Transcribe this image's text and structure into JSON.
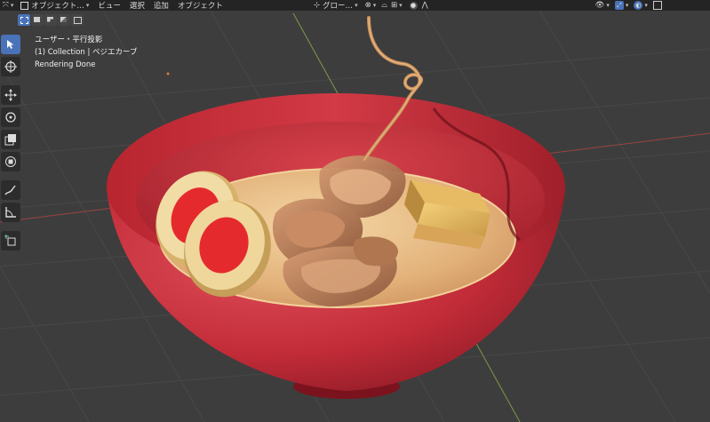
{
  "header": {
    "mode_label": "オブジェクト…",
    "menus": [
      "ビュー",
      "選択",
      "追加",
      "オブジェクト"
    ],
    "transform_orientation": "グロー…"
  },
  "overlay": {
    "view_name": "ユーザー・平行投影",
    "collection_info": "(1) Collection | ベジエカーブ",
    "status": "Rendering Done"
  },
  "colors": {
    "bowl": "#c8303c",
    "broth": "#e9c08d",
    "viewport_bg": "#3d3d3d",
    "grid": "#4a4a4a",
    "x_axis": "#b04848",
    "y_axis": "#88a84c",
    "active_tool": "#4a72b8"
  },
  "icons": {
    "toolbar": [
      "select-box-icon",
      "cursor-icon",
      "move-icon",
      "rotate-icon",
      "scale-icon",
      "transform-icon",
      "annotate-icon",
      "measure-icon",
      "add-cube-icon"
    ]
  }
}
